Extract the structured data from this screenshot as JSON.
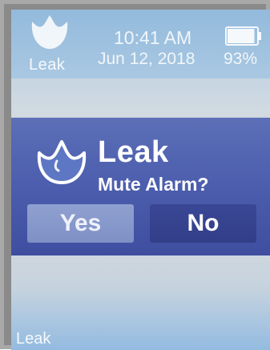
{
  "status_bar": {
    "alert_icon": "water-drop-icon",
    "alert_label": "Leak",
    "time": "10:41 AM",
    "date": "Jun 12, 2018",
    "battery_icon": "battery-icon",
    "battery_percent": "93%",
    "battery_level": 0.93
  },
  "dialog": {
    "icon": "water-drop-icon",
    "title": "Leak",
    "question": "Mute Alarm?",
    "yes_label": "Yes",
    "no_label": "No"
  },
  "footer": {
    "label": "Leak"
  },
  "colors": {
    "dialog_background": "#4d5fae",
    "yes_button": "#8fa0d0",
    "no_button": "#3a4795",
    "screen_background": "#cfd8df",
    "status_bar_background": "#9cc0de"
  }
}
